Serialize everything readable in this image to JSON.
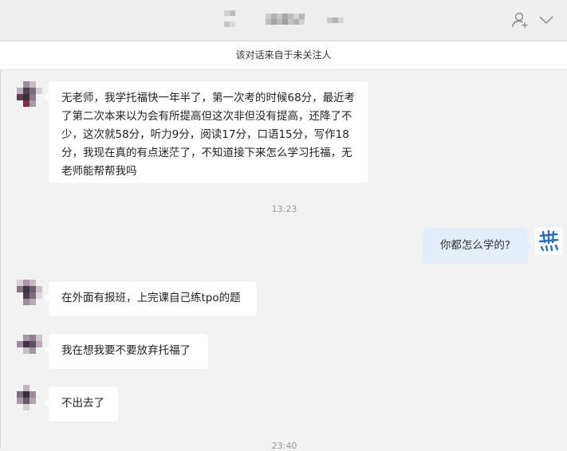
{
  "notice": {
    "text": "该对话来自于未关注人"
  },
  "icons": {
    "add_contact": "add-user-icon",
    "expand": "chevron-down-icon"
  },
  "messages": [
    {
      "from": "contact",
      "text": "无老师，我学托福快一年半了，第一次考的时候68分，最近考了第二次本来以为会有所提高但这次非但没有提高，还降了不少，这次就58分，听力9分，阅读17分，口语15分，写作18分，我现在真的有点迷茫了，不知道接下来怎么学习托福，无老师能帮帮我吗"
    },
    {
      "from": "me",
      "text": "你都怎么学的?"
    },
    {
      "from": "contact",
      "text": "在外面有报班，上完课自己练tpo的题"
    },
    {
      "from": "contact",
      "text": "我在想我要不要放弃托福了"
    },
    {
      "from": "contact",
      "text": "不出去了"
    }
  ],
  "timestamps": [
    "13:23",
    "23:40"
  ],
  "colors": {
    "background": "#f2f2f2",
    "contact_bubble": "#ffffff",
    "my_bubble": "#e3eef8",
    "timestamp": "#999999",
    "my_avatar_glyph": "#2a6fb5"
  }
}
